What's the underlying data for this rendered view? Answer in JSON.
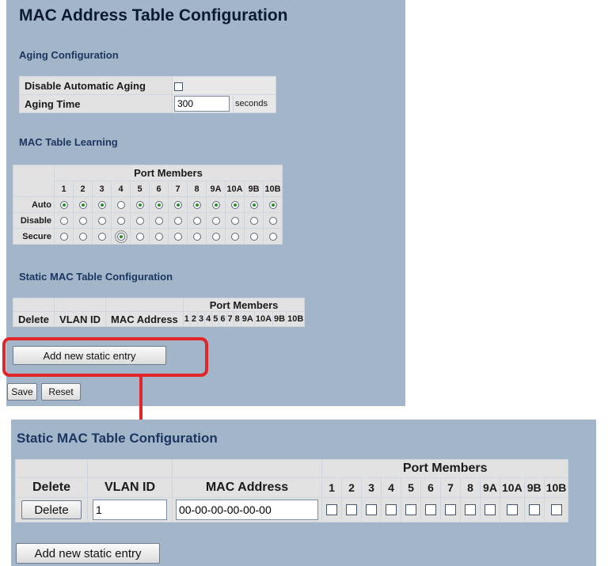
{
  "page_title": "MAC Address Table Configuration",
  "aging": {
    "heading": "Aging Configuration",
    "disable_label": "Disable Automatic Aging",
    "disable_checked": false,
    "time_label": "Aging Time",
    "time_value": "300",
    "time_unit": "seconds"
  },
  "learning": {
    "heading": "MAC Table Learning",
    "group_header": "Port Members",
    "ports": [
      "1",
      "2",
      "3",
      "4",
      "5",
      "6",
      "7",
      "8",
      "9A",
      "10A",
      "9B",
      "10B"
    ],
    "modes": [
      "Auto",
      "Disable",
      "Secure"
    ],
    "selected": [
      "Auto",
      "Auto",
      "Auto",
      "Secure",
      "Auto",
      "Auto",
      "Auto",
      "Auto",
      "Auto",
      "Auto",
      "Auto",
      "Auto"
    ],
    "focused_port": "4"
  },
  "static_table": {
    "heading": "Static MAC Table Configuration",
    "group_header": "Port Members",
    "col_delete": "Delete",
    "col_vlan": "VLAN ID",
    "col_mac": "MAC Address",
    "ports": [
      "1",
      "2",
      "3",
      "4",
      "5",
      "6",
      "7",
      "8",
      "9A",
      "10A",
      "9B",
      "10B"
    ],
    "add_button": "Add new static entry"
  },
  "buttons": {
    "save": "Save",
    "reset": "Reset"
  },
  "zoom": {
    "heading": "Static MAC Table Configuration",
    "group_header": "Port Members",
    "col_delete": "Delete",
    "col_vlan": "VLAN ID",
    "col_mac": "MAC Address",
    "ports": [
      "1",
      "2",
      "3",
      "4",
      "5",
      "6",
      "7",
      "8",
      "9A",
      "10A",
      "9B",
      "10B"
    ],
    "row": {
      "delete_button": "Delete",
      "vlan_id": "1",
      "mac_address": "00-00-00-00-00-00"
    },
    "add_button": "Add new static entry"
  },
  "colors": {
    "panel": "#a3b6c9",
    "cell": "#e2e2e2",
    "highlight": "#e12529",
    "radio_dot": "#2f8a2f"
  }
}
